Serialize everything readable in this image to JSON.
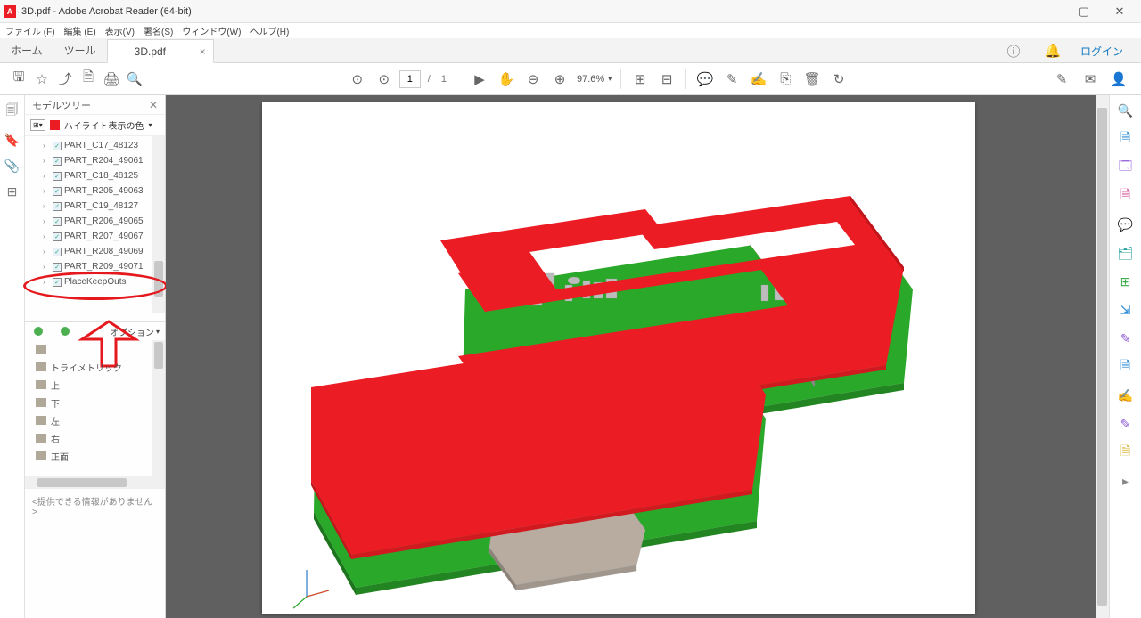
{
  "window": {
    "title": "3D.pdf - Adobe Acrobat Reader (64-bit)",
    "min": "—",
    "max": "▢",
    "close": "✕"
  },
  "menu": {
    "file": "ファイル (F)",
    "edit": "編集 (E)",
    "view": "表示(V)",
    "sign": "署名(S)",
    "window": "ウィンドウ(W)",
    "help": "ヘルプ(H)"
  },
  "tabs": {
    "home": "ホーム",
    "tool": "ツール",
    "file": "3D.pdf",
    "login": "ログイン"
  },
  "toolbar": {
    "page_current": "1",
    "page_sep": "/",
    "page_total": "1",
    "zoom": "97.6%"
  },
  "modeltree": {
    "title": "モデルツリー",
    "highlight_label": "ハイライト表示の色",
    "items": [
      "PART_C17_48123",
      "PART_R204_49061",
      "PART_C18_48125",
      "PART_R205_49063",
      "PART_C19_48127",
      "PART_R206_49065",
      "PART_R207_49067",
      "PART_R208_49069",
      "PART_R209_49071",
      "PlaceKeepOuts"
    ]
  },
  "viewsbar": {
    "options": "オプション"
  },
  "views": [
    "トライメトリック",
    "上",
    "下",
    "左",
    "右",
    "正面"
  ],
  "bottom_info": "<提供できる情報がありません>",
  "annotations": {
    "oval_highlights": "PlaceKeepOuts row in model tree",
    "arrow_highlights": "views panel top controls"
  }
}
